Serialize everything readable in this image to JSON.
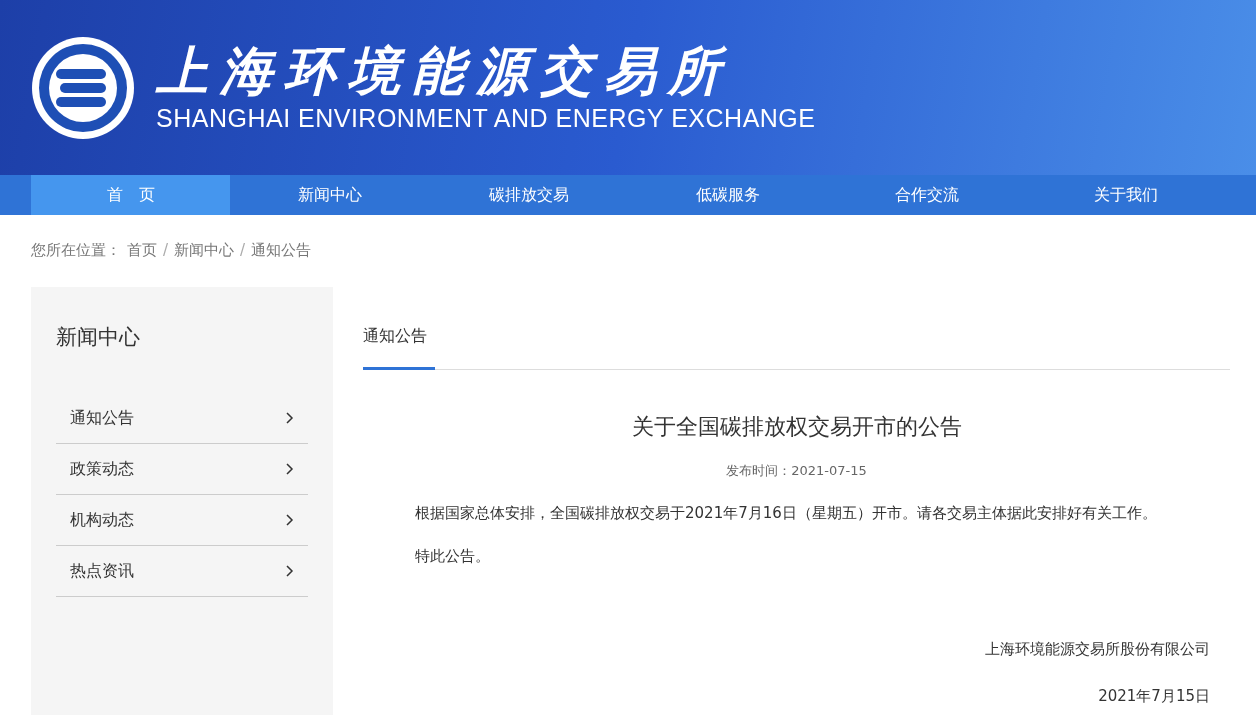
{
  "header": {
    "title": "上海环境能源交易所",
    "subtitle": "SHANGHAI ENVIRONMENT AND ENERGY EXCHANGE"
  },
  "nav": [
    {
      "label": "首　页",
      "selected": true
    },
    {
      "label": "新闻中心",
      "selected": false
    },
    {
      "label": "碳排放交易",
      "selected": false
    },
    {
      "label": "低碳服务",
      "selected": false
    },
    {
      "label": "合作交流",
      "selected": false
    },
    {
      "label": "关于我们",
      "selected": false
    }
  ],
  "breadcrumb": {
    "label": "您所在位置：",
    "items": [
      "首页",
      "新闻中心",
      "通知公告"
    ],
    "separators": [
      "/",
      "/"
    ]
  },
  "sidebar": {
    "title": "新闻中心",
    "items": [
      {
        "label": "通知公告"
      },
      {
        "label": "政策动态"
      },
      {
        "label": "机构动态"
      },
      {
        "label": "热点资讯"
      }
    ]
  },
  "tab": "通知公告",
  "article": {
    "title": "关于全国碳排放权交易开市的公告",
    "date": "发布时间：2021-07-15",
    "paragraphs": [
      "根据国家总体安排，全国碳排放权交易于2021年7月16日（星期五）开市。请各交易主体据此安排好有关工作。",
      "特此公告。"
    ],
    "signature": "上海环境能源交易所股份有限公司",
    "signed_date": "2021年7月15日"
  }
}
